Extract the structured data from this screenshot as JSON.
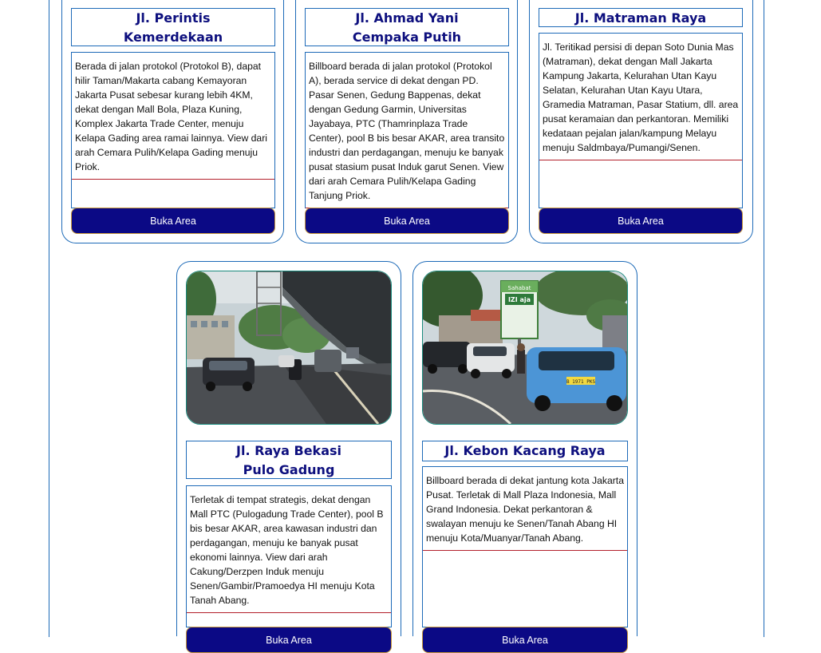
{
  "locations_top": [
    {
      "title_line1": "Jl. Perintis",
      "title_line2": "Kemerdekaan",
      "description": "Berada di jalan protokol (Protokol B), dapat hilir Taman/Makarta cabang Kemayoran Jakarta Pusat sebesar kurang lebih 4KM, dekat dengan Mall Bola, Plaza Kuning, Komplex Jakarta Trade Center, menuju Kelapa Gading area ramai lainnya. View dari arah Cemara Pulih/Kelapa Gading menuju Priok.",
      "button_label": "Buka Area"
    },
    {
      "title_line1": "Jl. Ahmad Yani",
      "title_line2": "Cempaka Putih",
      "description": "Billboard berada di jalan protokol (Protokol A), berada service di dekat dengan PD. Pasar Senen, Gedung Bappenas, dekat dengan Gedung Garmin, Universitas Jayabaya, PTC (Thamrinplaza Trade Center), pool B bis besar AKAR, area transito industri dan perdagangan, menuju ke banyak pusat stasium pusat Induk garut Senen. View dari arah Cemara Pulih/Kelapa Gading Tanjung Priok.",
      "button_label": "Buka Area"
    },
    {
      "title_line1": "Jl. Matraman Raya",
      "title_line2": "",
      "description": "Jl. Teritikad persisi di depan Soto Dunia Mas (Matraman), dekat dengan Mall Jakarta Kampung Jakarta, Kelurahan Utan Kayu Selatan, Kelurahan Utan Kayu Utara, Gramedia Matraman, Pasar Statium, dll. area pusat keramaian dan perkantoran. Memiliki kedataan pejalan jalan/kampung Melayu menuju Saldmbaya/Pumangi/Senen.",
      "button_label": "Buka Area"
    }
  ],
  "locations_bottom": [
    {
      "title_line1": "Jl. Raya Bekasi",
      "title_line2": "Pulo Gadung",
      "description": "Terletak di tempat strategis, dekat dengan Mall PTC (Pulogadung Trade Center), pool B bis besar AKAR, area kawasan industri dan perdagangan, menuju ke banyak pusat ekonomi lainnya. View dari arah Cakung/Derzpen Induk menuju Senen/Gambir/Pramoedya HI menuju Kota Tanah Abang.",
      "button_label": "Buka Area"
    },
    {
      "title_line1": "Jl. Kebon Kacang Raya",
      "title_line2": "",
      "description": "Billboard berada di dekat jantung kota Jakarta Pusat. Terletak di Mall Plaza Indonesia, Mall Grand Indonesia. Dekat perkantoran & swalayan menuju ke Senen/Tanah Abang HI menuju Kota/Muanyar/Tanah Abang.",
      "button_label": "Buka Area"
    }
  ],
  "billboard_sign": {
    "line1": "Sahabat",
    "line2": "IZI aja",
    "plate": "B 1971 PKS"
  },
  "colors": {
    "title": "#0d0f7e",
    "border": "#1d6ab8",
    "button_bg": "#0b0985",
    "divider": "#b3202b"
  }
}
